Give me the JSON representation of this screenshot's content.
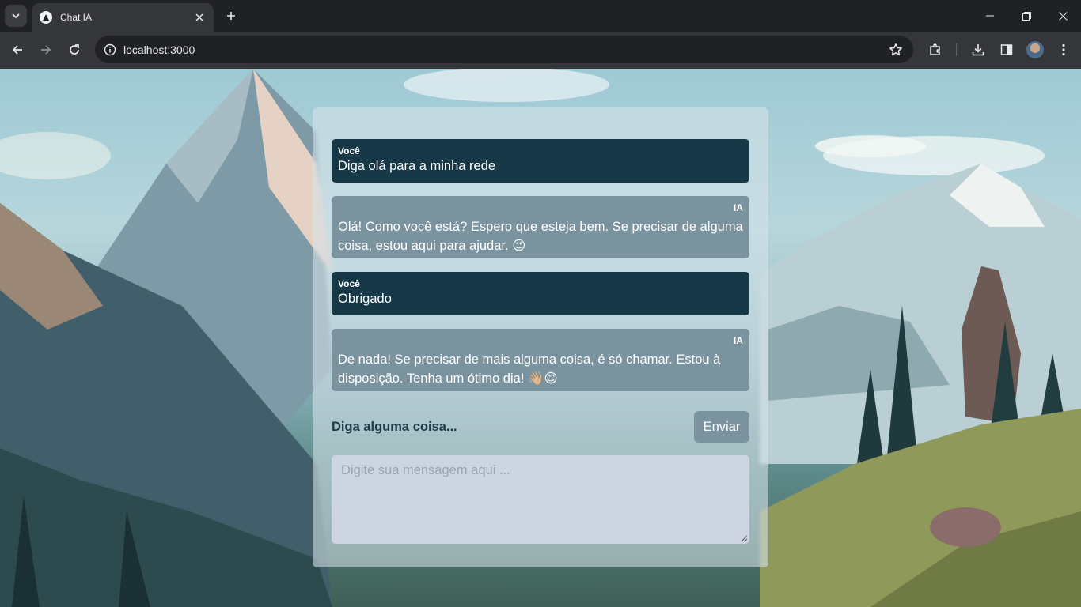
{
  "browser": {
    "tab_title": "Chat IA",
    "url": "localhost:3000"
  },
  "chat": {
    "messages": [
      {
        "sender": "Você",
        "text": "Diga olá para a minha rede"
      },
      {
        "sender": "IA",
        "text": "Olá! Como você está? Espero que esteja bem. Se precisar de alguma coisa, estou aqui para ajudar. 😉"
      },
      {
        "sender": "Você",
        "text": "Obrigado"
      },
      {
        "sender": "IA",
        "text": "De nada! Se precisar de mais alguma coisa, é só chamar. Estou à disposição. Tenha um ótimo dia! 👋🏼😊"
      }
    ],
    "prompt_label": "Diga alguma coisa...",
    "send_label": "Enviar",
    "input_placeholder": "Digite sua mensagem aqui ..."
  },
  "colors": {
    "user_bubble": "#173846",
    "ai_bubble": "#7a939e",
    "send_button": "#7a939e",
    "input_bg": "#ccd5e1"
  },
  "icons": {
    "tab_search": "chevron-down-icon",
    "favicon": "triangle-logo-icon",
    "tab_close": "close-icon",
    "new_tab": "plus-icon",
    "back": "arrow-left-icon",
    "forward": "arrow-right-icon",
    "reload": "reload-icon",
    "site_info": "info-icon",
    "bookmark": "star-icon",
    "extensions": "puzzle-icon",
    "downloads": "download-icon",
    "side_panel": "side-panel-icon",
    "menu": "kebab-menu-icon"
  }
}
